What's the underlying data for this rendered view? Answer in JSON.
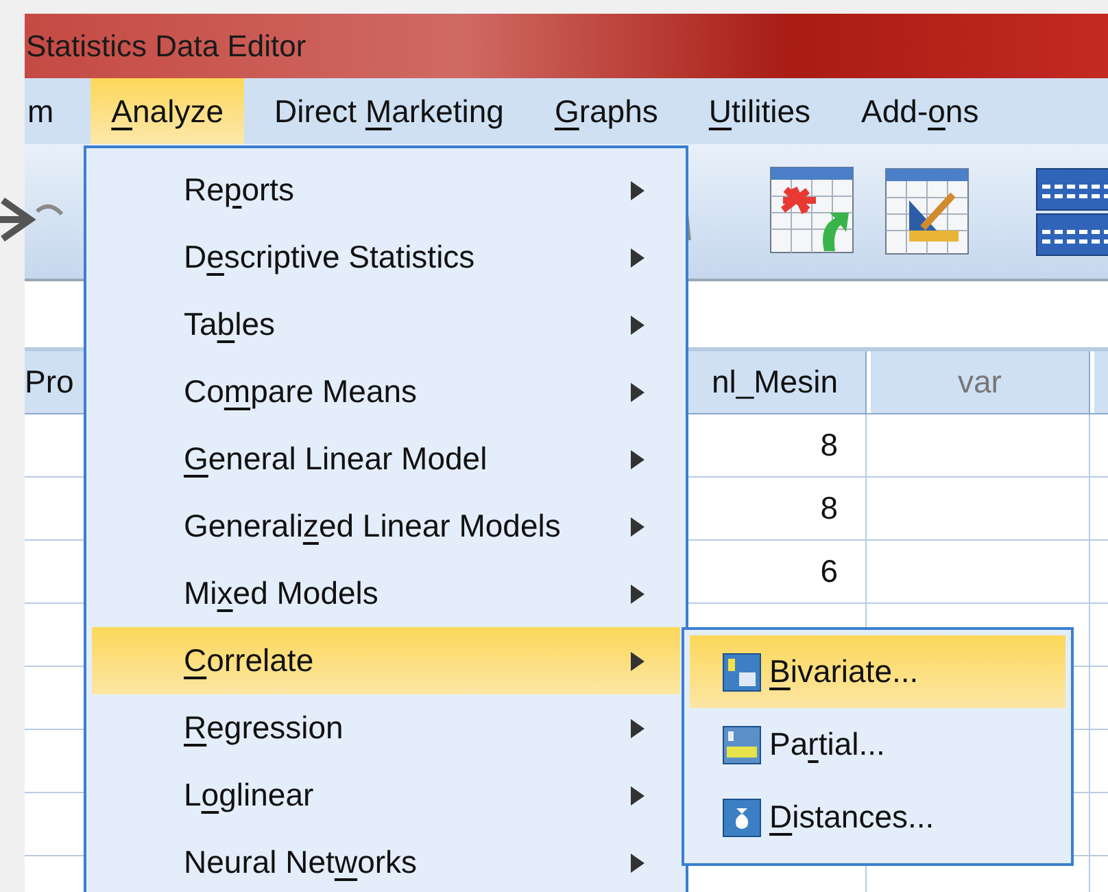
{
  "window": {
    "title": "Statistics Data Editor"
  },
  "menu_bar": [
    {
      "label": {
        "before": "m"
      },
      "selected": false
    },
    {
      "label": {
        "key": "A",
        "after": "nalyze"
      },
      "selected": true
    },
    {
      "label": {
        "before": "Direct ",
        "key": "M",
        "after": "arketing"
      },
      "selected": false
    },
    {
      "label": {
        "key": "G",
        "after": "raphs"
      },
      "selected": false
    },
    {
      "label": {
        "key": "U",
        "after": "tilities"
      },
      "selected": false
    },
    {
      "label": {
        "before": "Add-",
        "key": "o",
        "after": "ns"
      },
      "selected": false
    }
  ],
  "grid": {
    "columns": [
      "Pro",
      "nl_Mesin",
      "var"
    ],
    "rows": [
      {
        "nl_mesin": "8"
      },
      {
        "nl_mesin": "8"
      },
      {
        "nl_mesin": "6"
      }
    ]
  },
  "analyze_menu": [
    {
      "label": {
        "before": "Re",
        "key": "p",
        "after": "orts"
      },
      "selected": false
    },
    {
      "label": {
        "before": "D",
        "key": "e",
        "after": "scriptive Statistics"
      },
      "selected": false
    },
    {
      "label": {
        "before": "Ta",
        "key": "b",
        "after": "les"
      },
      "selected": false
    },
    {
      "label": {
        "before": "Co",
        "key": "m",
        "after": "pare Means"
      },
      "selected": false
    },
    {
      "label": {
        "key": "G",
        "after": "eneral Linear Model"
      },
      "selected": false
    },
    {
      "label": {
        "before": "Generali",
        "key": "z",
        "after": "ed Linear Models"
      },
      "selected": false
    },
    {
      "label": {
        "before": "Mi",
        "key": "x",
        "after": "ed Models"
      },
      "selected": false
    },
    {
      "label": {
        "key": "C",
        "after": "orrelate"
      },
      "selected": true
    },
    {
      "label": {
        "key": "R",
        "after": "egression"
      },
      "selected": false
    },
    {
      "label": {
        "before": "L",
        "key": "o",
        "after": "glinear"
      },
      "selected": false
    },
    {
      "label": {
        "before": "Neural Net",
        "key": "w",
        "after": "orks"
      },
      "selected": false
    }
  ],
  "correlate_submenu": [
    {
      "kind": "bivariate",
      "label": {
        "key": "B",
        "after": "ivariate..."
      },
      "selected": true
    },
    {
      "kind": "partial",
      "label": {
        "before": "Pa",
        "key": "r",
        "after": "tial..."
      },
      "selected": false
    },
    {
      "kind": "distances",
      "label": {
        "key": "D",
        "after": "istances..."
      },
      "selected": false
    }
  ]
}
